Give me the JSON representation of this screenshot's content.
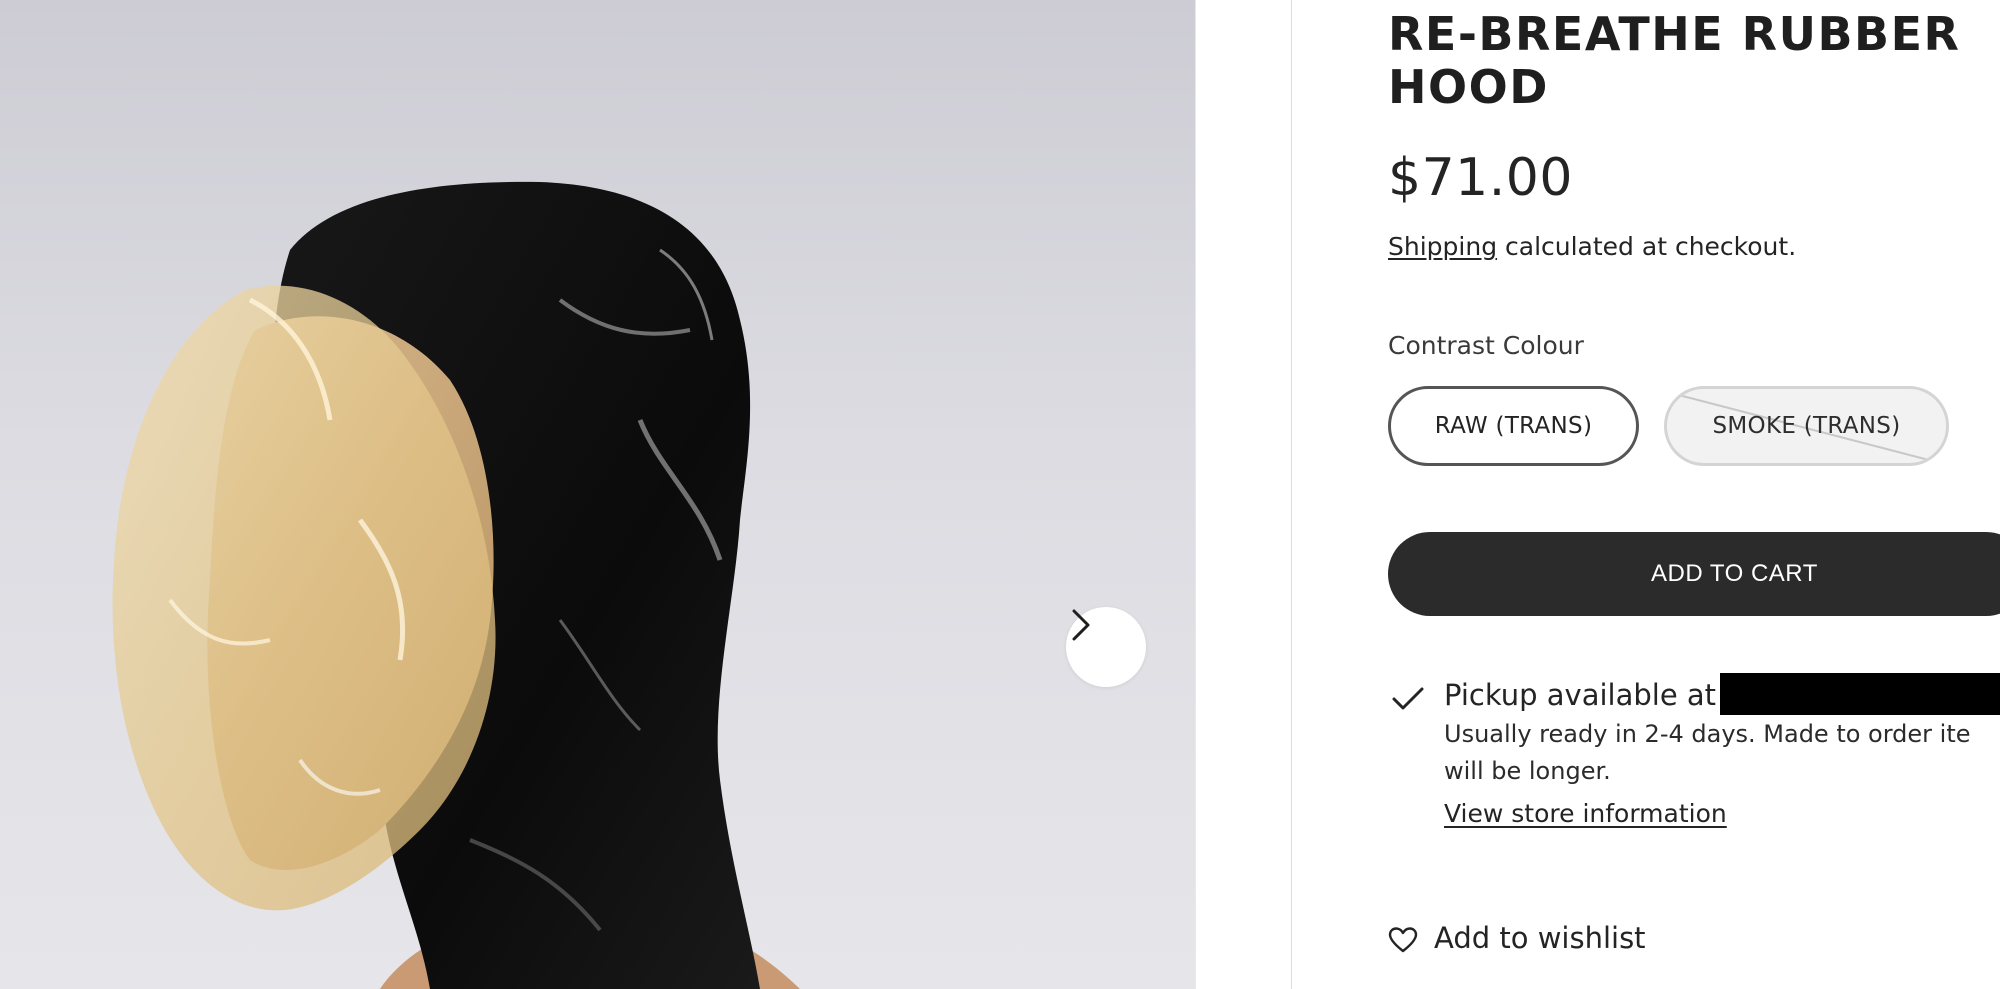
{
  "product": {
    "title": "RE-BREATHE RUBBER HOOD",
    "price": "$71.00",
    "shipping_link": "Shipping",
    "shipping_suffix": " calculated at checkout."
  },
  "options": {
    "label": "Contrast Colour",
    "values": [
      {
        "label": "RAW (TRANS)",
        "selected": true,
        "available": true
      },
      {
        "label": "SMOKE (TRANS)",
        "selected": false,
        "available": false
      }
    ]
  },
  "cart": {
    "add_label": "ADD TO CART"
  },
  "pickup": {
    "title": "Pickup available at",
    "detail_line1": "Usually ready in 2-4 days. Made to order ite",
    "detail_line2": "will be longer.",
    "store_link": "View store information"
  },
  "wishlist": {
    "label": "Add to wishlist"
  },
  "icons": {
    "next": "chevron-right-icon",
    "pickup": "check-icon",
    "wishlist": "heart-icon"
  },
  "colors": {
    "button_dark": "#2b2b2b",
    "text": "#242424",
    "photo_background": "#d8d8de"
  }
}
